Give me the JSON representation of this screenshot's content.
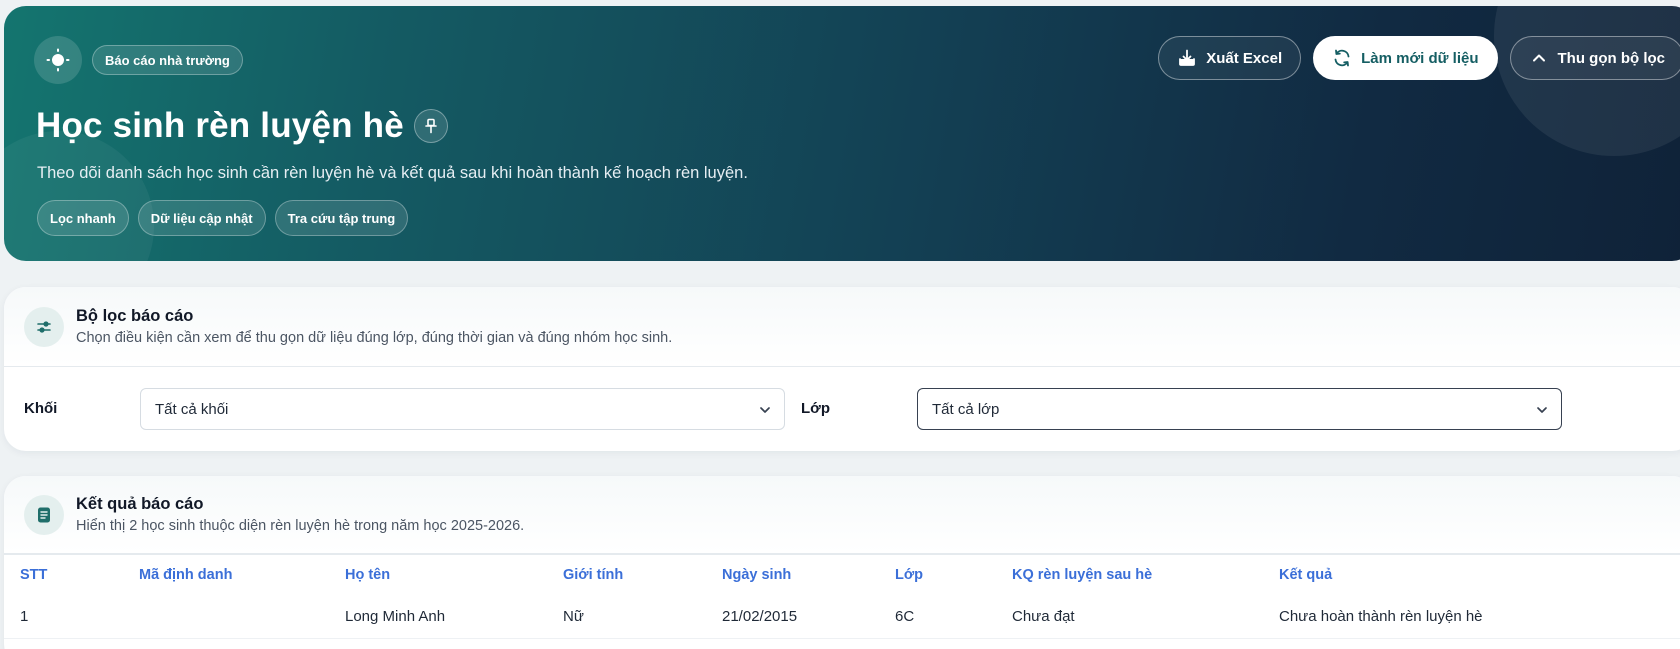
{
  "hero": {
    "badge": "Báo cáo nhà trường",
    "title": "Học sinh rèn luyện hè",
    "description": "Theo dõi danh sách học sinh cần rèn luyện hè và kết quả sau khi hoàn thành kế hoạch rèn luyện.",
    "chips": [
      "Lọc nhanh",
      "Dữ liệu cập nhật",
      "Tra cứu tập trung"
    ],
    "actions": {
      "export": "Xuất Excel",
      "refresh": "Làm mới dữ liệu",
      "collapse": "Thu gọn bộ lọc"
    }
  },
  "filter": {
    "title": "Bộ lọc báo cáo",
    "subtitle": "Chọn điều kiện cần xem để thu gọn dữ liệu đúng lớp, đúng thời gian và đúng nhóm học sinh.",
    "grade_label": "Khối",
    "grade_value": "Tất cả khối",
    "class_label": "Lớp",
    "class_value": "Tất cả lớp"
  },
  "results": {
    "title": "Kết quả báo cáo",
    "subtitle": "Hiển thị 2 học sinh thuộc diện rèn luyện hè trong năm học 2025-2026.",
    "columns": [
      "STT",
      "Mã định danh",
      "Họ tên",
      "Giới tính",
      "Ngày sinh",
      "Lớp",
      "KQ rèn luyện sau hè",
      "Kết quả"
    ],
    "rows": [
      [
        "1",
        "",
        "Long Minh Anh",
        "Nữ",
        "21/02/2015",
        "6C",
        "Chưa đạt",
        "Chưa hoàn thành rèn luyện hè"
      ]
    ]
  },
  "colors": {
    "hero_start": "#14756f",
    "hero_end": "#0f2238",
    "header_blue": "#3b6fd8",
    "accent_teal": "#155e63"
  }
}
